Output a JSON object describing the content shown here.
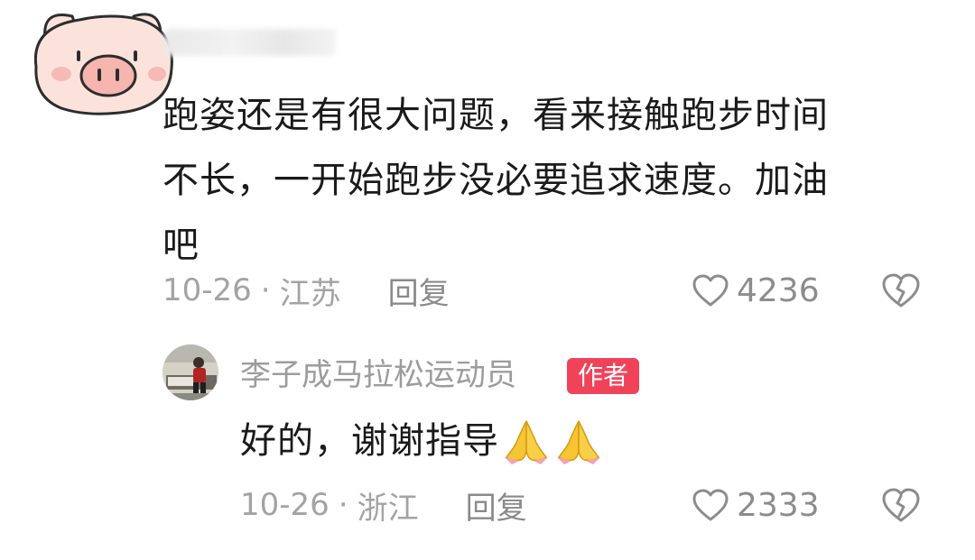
{
  "comment": {
    "text_lines": [
      "跑姿还是有很大问题，看来接触跑步时间",
      "不长，一开始跑步没必要追求速度。加油",
      "吧"
    ],
    "date": "10-26",
    "separator": "·",
    "location": "江苏",
    "reply_label": "回复",
    "like_count": "4236"
  },
  "reply": {
    "username": "李子成马拉松运动员",
    "badge": "作者",
    "text": "好的，谢谢指导",
    "date": "10-26",
    "separator": "·",
    "location": "浙江",
    "reply_label": "回复",
    "like_count": "2333"
  },
  "colors": {
    "badge_bg": "#f0435a",
    "meta_text": "#a3a3a3",
    "body_text": "#1a1a1a",
    "pig_fill": "#fbe3dc",
    "pig_nose": "#f7b5b0"
  },
  "icons": {
    "avatar": "pig-face-icon",
    "like": "heart-outline-icon",
    "dislike": "broken-heart-icon",
    "emoji": "praying-hands-icon"
  }
}
